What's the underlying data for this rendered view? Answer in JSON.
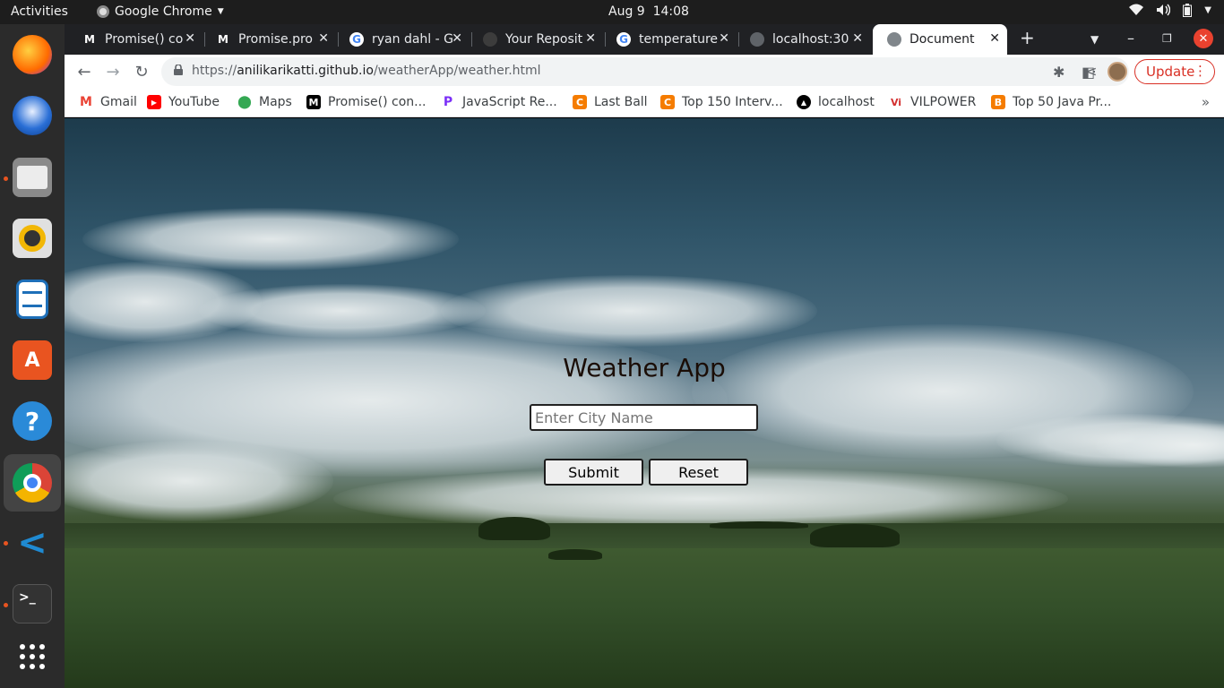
{
  "system": {
    "activities": "Activities",
    "app_name": "Google Chrome",
    "date": "Aug 9",
    "time": "14:08"
  },
  "browser": {
    "tabs": [
      {
        "title": "Promise() co",
        "icon": "mdn-icon"
      },
      {
        "title": "Promise.pro",
        "icon": "mdn-icon"
      },
      {
        "title": "ryan dahl - G",
        "icon": "google-icon"
      },
      {
        "title": "Your Reposit",
        "icon": "github-icon"
      },
      {
        "title": "temperature",
        "icon": "google-icon"
      },
      {
        "title": "localhost:30",
        "icon": "globe-icon"
      },
      {
        "title": "Document",
        "icon": "globe-icon",
        "active": true
      }
    ],
    "url_prefix": "https://",
    "url_domain": "anilikarikatti.github.io",
    "url_path": "/weatherApp/weather.html",
    "update_label": "Update",
    "bookmarks": [
      {
        "label": "Gmail",
        "color": "#ea4335"
      },
      {
        "label": "YouTube",
        "color": "#ff0000"
      },
      {
        "label": "Maps",
        "color": "#34a853"
      },
      {
        "label": "Promise() con...",
        "color": "#000000"
      },
      {
        "label": "JavaScript Re...",
        "color": "#7b2ff7"
      },
      {
        "label": "Last Ball",
        "color": "#f57c00"
      },
      {
        "label": "Top 150 Interv...",
        "color": "#f57c00"
      },
      {
        "label": "localhost",
        "color": "#000000"
      },
      {
        "label": "VILPOWER",
        "color": "#d32f2f"
      },
      {
        "label": "Top 50 Java Pr...",
        "color": "#f57c00"
      }
    ]
  },
  "page": {
    "title": "Weather App",
    "city_placeholder": "Enter City Name",
    "city_value": "",
    "submit_label": "Submit",
    "reset_label": "Reset"
  },
  "colors": {
    "accent_red": "#d93025",
    "ubuntu_orange": "#e95420"
  }
}
